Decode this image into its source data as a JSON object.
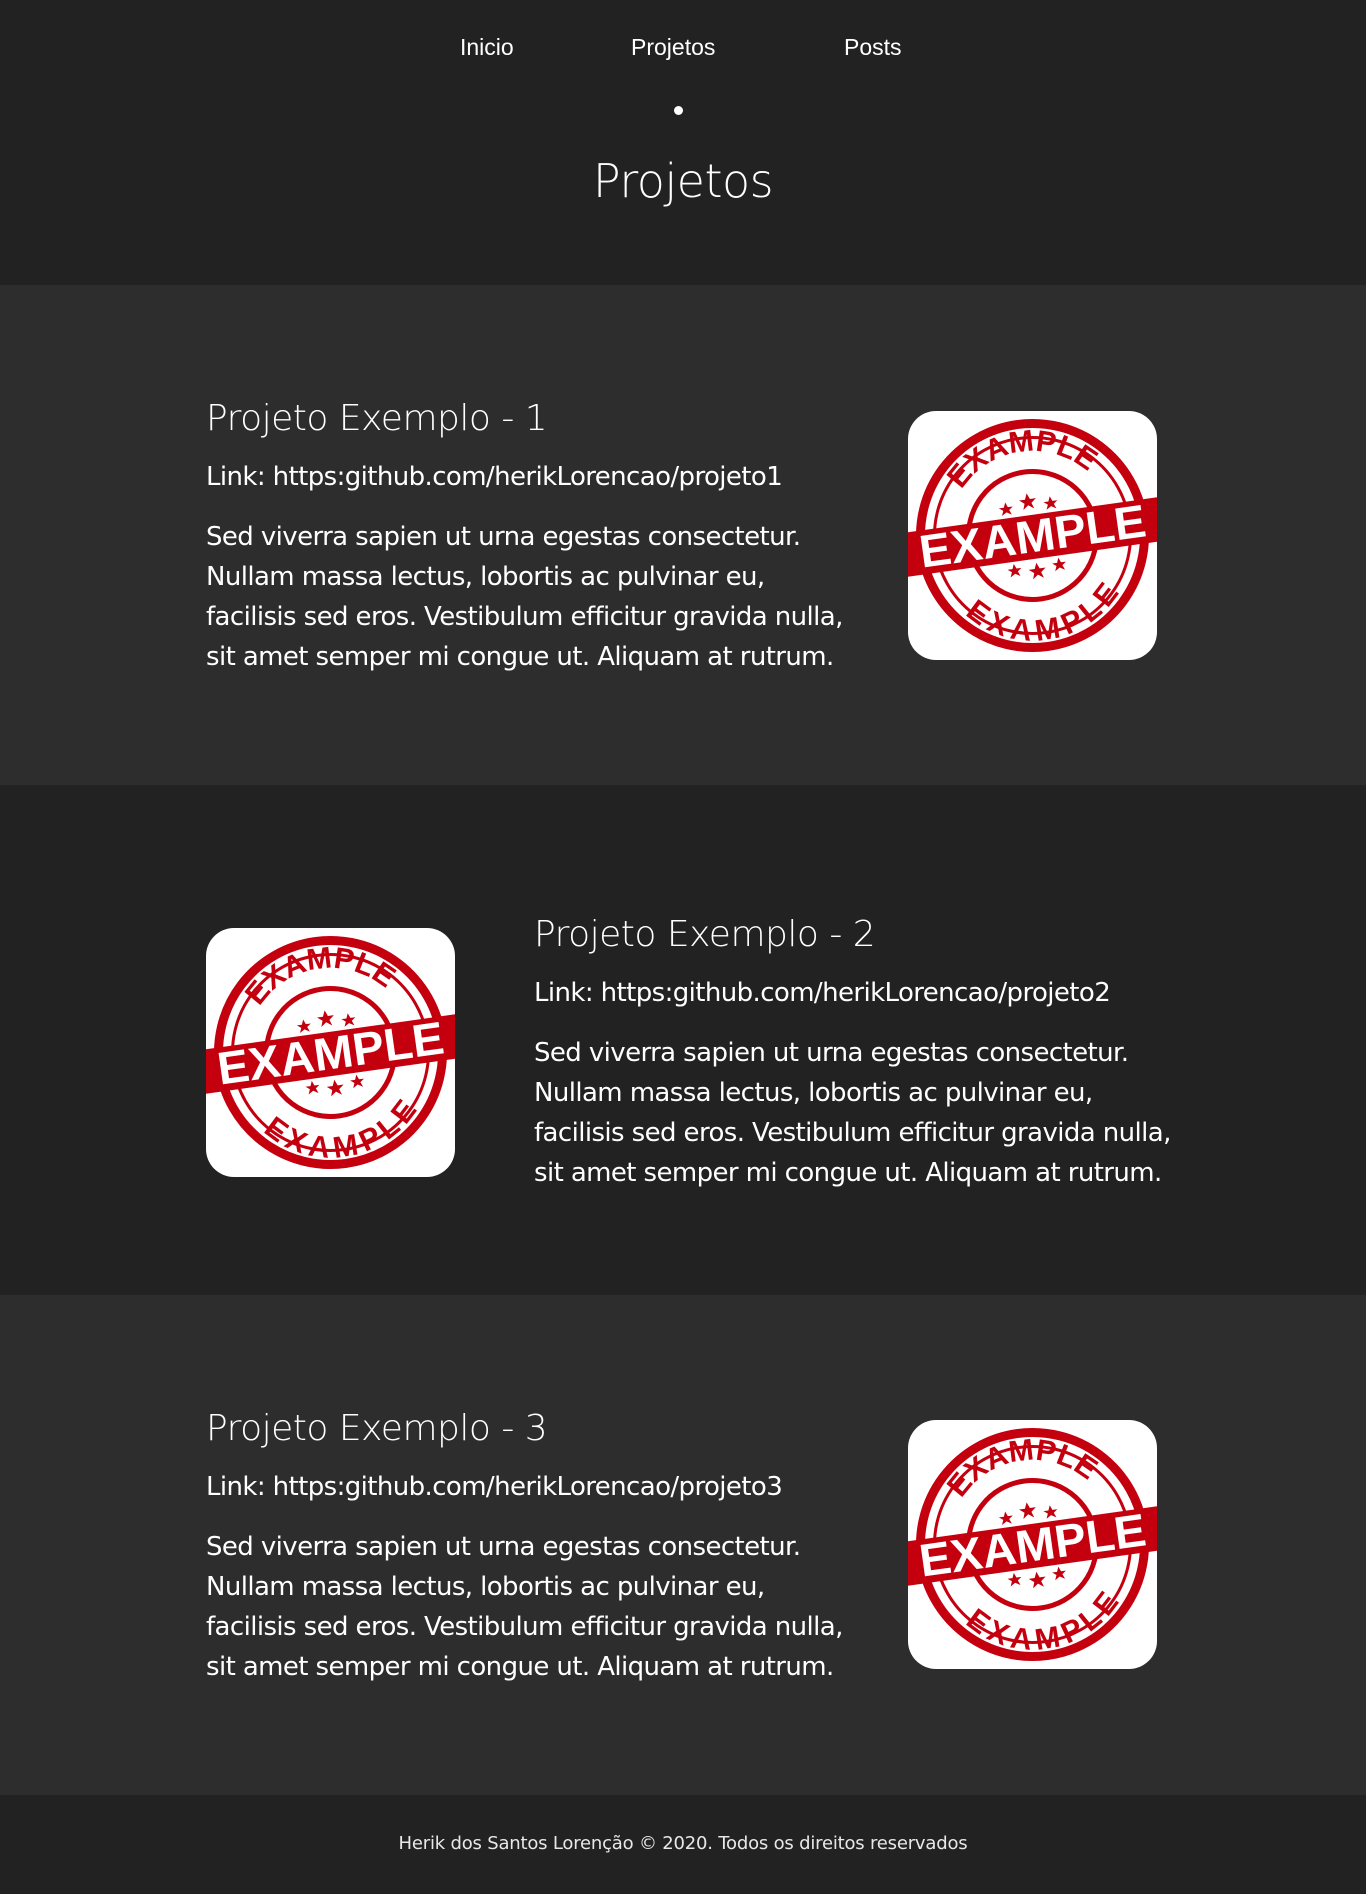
{
  "nav": {
    "items": [
      {
        "label": "Inicio"
      },
      {
        "label": "Projetos"
      },
      {
        "label": "Posts"
      }
    ],
    "active": "Projetos"
  },
  "page": {
    "title": "Projetos"
  },
  "projects": [
    {
      "title": "Projeto Exemplo - 1",
      "link": "Link: https:github.com/herikLorencao/projeto1",
      "description": "Sed viverra sapien ut urna egestas consectetur. Nullam massa lectus, lobortis ac pulvinar eu, facilisis sed eros. Vestibulum efficitur gravida nulla, sit amet semper mi congue ut. Aliquam at rutrum.",
      "image": {
        "top_text": "EXAMPLE",
        "center_text": "EXAMPLE",
        "bottom_text": "EXAMPLE"
      }
    },
    {
      "title": "Projeto Exemplo - 2",
      "link": "Link: https:github.com/herikLorencao/projeto2",
      "description": "Sed viverra sapien ut urna egestas consectetur. Nullam massa lectus, lobortis ac pulvinar eu, facilisis sed eros. Vestibulum efficitur gravida nulla, sit amet semper mi congue ut. Aliquam at rutrum.",
      "image": {
        "top_text": "EXAMPLE",
        "center_text": "EXAMPLE",
        "bottom_text": "EXAMPLE"
      }
    },
    {
      "title": "Projeto Exemplo - 3",
      "link": "Link: https:github.com/herikLorencao/projeto3",
      "description": "Sed viverra sapien ut urna egestas consectetur. Nullam massa lectus, lobortis ac pulvinar eu, facilisis sed eros. Vestibulum efficitur gravida nulla, sit amet semper mi congue ut. Aliquam at rutrum.",
      "image": {
        "top_text": "EXAMPLE",
        "center_text": "EXAMPLE",
        "bottom_text": "EXAMPLE"
      }
    }
  ],
  "footer": {
    "text": "Herik dos Santos Lorenção © 2020. Todos os direitos reservados"
  },
  "colors": {
    "header_bg": "#222222",
    "section_alt_bg": "#2d2d2d",
    "text": "#ffffff",
    "stamp_red": "#c4000f"
  }
}
